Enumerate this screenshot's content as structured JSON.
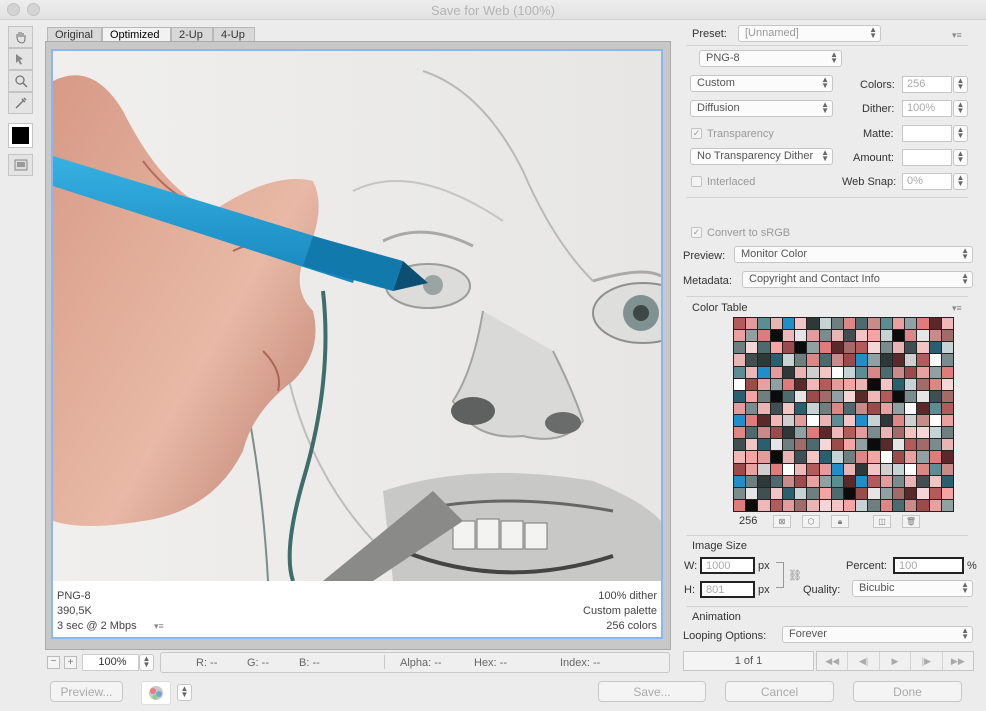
{
  "window": {
    "title": "Save for Web (100%)"
  },
  "tabs": [
    "Original",
    "Optimized",
    "2-Up",
    "4-Up"
  ],
  "preview_info": {
    "format": "PNG-8",
    "size": "390,5K",
    "time": "3 sec @ 2 Mbps",
    "dither": "100% dither",
    "palette": "Custom palette",
    "colors": "256 colors"
  },
  "settings": {
    "preset_label": "Preset:",
    "preset_value": "[Unnamed]",
    "format": "PNG-8",
    "reduction": "Custom",
    "dither_algo": "Diffusion",
    "transparency_label": "Transparency",
    "transparency_dither": "No Transparency Dither",
    "interlaced_label": "Interlaced",
    "colors_label": "Colors:",
    "colors_value": "256",
    "dither_label": "Dither:",
    "dither_value": "100%",
    "matte_label": "Matte:",
    "amount_label": "Amount:",
    "websnap_label": "Web Snap:",
    "websnap_value": "0%",
    "convert_srgb": "Convert to sRGB",
    "preview_label": "Preview:",
    "preview_value": "Monitor Color",
    "metadata_label": "Metadata:",
    "metadata_value": "Copyright and Contact Info"
  },
  "color_table": {
    "title": "Color Table",
    "count": "256",
    "colors": [
      "#b35a5a",
      "#e8a0a0",
      "#6e7f80",
      "#e8b4b4",
      "#5a2a2a",
      "#c98a8a",
      "#2a5f70",
      "#e39b9b",
      "#8fa1a3",
      "#dd8686",
      "#3f4f52",
      "#efb7b7",
      "#9b4b4b",
      "#c5d3d4",
      "#7a8c8e",
      "#e07b7b",
      "#4c6b6f",
      "#f2c4c4"
    ]
  },
  "image_size": {
    "title": "Image Size",
    "w_label": "W:",
    "w_value": "1000",
    "h_label": "H:",
    "h_value": "801",
    "unit": "px",
    "percent_label": "Percent:",
    "percent_value": "100",
    "percent_unit": "%",
    "quality_label": "Quality:",
    "quality_value": "Bicubic"
  },
  "animation": {
    "title": "Animation",
    "looping_label": "Looping Options:",
    "looping_value": "Forever",
    "frame": "1 of 1"
  },
  "statusbar": {
    "zoom": "100%",
    "r": "R: --",
    "g": "G: --",
    "b": "B: --",
    "alpha": "Alpha: --",
    "hex": "Hex: --",
    "index": "Index: --"
  },
  "buttons": {
    "preview": "Preview...",
    "save": "Save...",
    "cancel": "Cancel",
    "done": "Done"
  }
}
